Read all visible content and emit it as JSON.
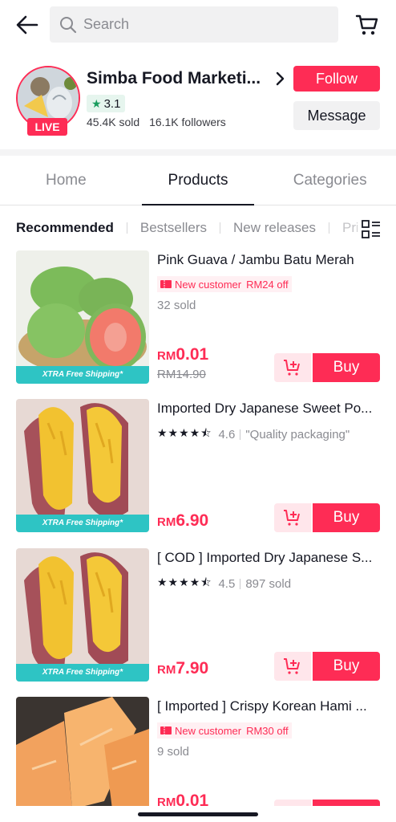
{
  "search": {
    "placeholder": "Search"
  },
  "shop": {
    "name": "Simba Food Marketi...",
    "rating": "3.1",
    "sold": "45.4K sold",
    "followers": "16.1K followers",
    "live_label": "LIVE",
    "follow_label": "Follow",
    "message_label": "Message"
  },
  "tabs": [
    {
      "label": "Home"
    },
    {
      "label": "Products"
    },
    {
      "label": "Categories"
    }
  ],
  "subtabs": [
    {
      "label": "Recommended"
    },
    {
      "label": "Bestsellers"
    },
    {
      "label": "New releases"
    },
    {
      "label": "Pri"
    }
  ],
  "products": [
    {
      "title": "Pink Guava / Jambu Batu Merah",
      "promo_label": "New customer",
      "promo_off": "RM24 off",
      "sold": "32 sold",
      "currency": "RM",
      "price": "0.01",
      "old_price": "RM14.90",
      "shipping": "XTRA Free Shipping*",
      "buy_label": "Buy"
    },
    {
      "title": "Imported  Dry Japanese Sweet Po...",
      "rating": "4.6",
      "rating_stars": 4.6,
      "tag": "\"Quality packaging\"",
      "currency": "RM",
      "price": "6.90",
      "shipping": "XTRA Free Shipping*",
      "buy_label": "Buy"
    },
    {
      "title": "[ COD ] Imported  Dry Japanese S...",
      "rating": "4.5",
      "rating_stars": 4.5,
      "sold": "897 sold",
      "currency": "RM",
      "price": "7.90",
      "shipping": "XTRA Free Shipping*",
      "buy_label": "Buy"
    },
    {
      "title": "[ Imported ] Crispy Korean Hami ...",
      "promo_label": "New customer",
      "promo_off": "RM30 off",
      "sold": "9 sold",
      "currency": "RM",
      "price": "0.01"
    }
  ],
  "colors": {
    "accent": "#fe2c55",
    "rating_green": "#1a9c5e",
    "shipping_teal": "#2ec4c4"
  }
}
